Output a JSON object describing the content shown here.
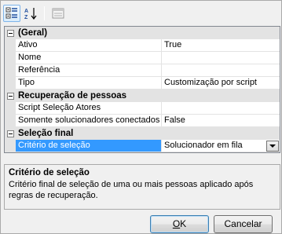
{
  "toolbar": {
    "buttons": [
      {
        "name": "categorized-view",
        "icon": "categorized-icon",
        "pressed": true
      },
      {
        "name": "alphabetical-view",
        "icon": "sort-az-icon",
        "pressed": false
      },
      {
        "name": "property-pages",
        "icon": "property-pages-icon",
        "pressed": false
      }
    ]
  },
  "grid": {
    "categories": [
      {
        "label": "(Geral)",
        "properties": [
          {
            "name": "Ativo",
            "value": "True"
          },
          {
            "name": "Nome",
            "value": ""
          },
          {
            "name": "Referência",
            "value": ""
          },
          {
            "name": "Tipo",
            "value": "Customização por script"
          }
        ]
      },
      {
        "label": "Recuperação de pessoas",
        "properties": [
          {
            "name": "Script Seleção Atores",
            "value": ""
          },
          {
            "name": "Somente solucionadores conectados",
            "value": "False"
          }
        ]
      },
      {
        "label": "Seleção final",
        "properties": [
          {
            "name": "Critério de seleção",
            "value": "Solucionador em fila",
            "selected": true
          }
        ]
      }
    ]
  },
  "help": {
    "title": "Critério de seleção",
    "description": "Critério final de seleção de uma ou mais pessoas aplicado após regras de recuperação."
  },
  "buttons": {
    "ok_underlined": "O",
    "ok_rest": "K",
    "cancel": "Cancelar"
  },
  "colors": {
    "selection": "#3399ff",
    "category_bg": "#e3e3e3"
  }
}
